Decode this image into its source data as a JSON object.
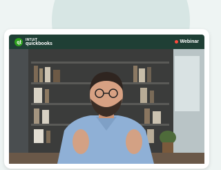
{
  "header": {
    "brand_top": "INTUIT",
    "brand_bottom": "quickbooks",
    "badge_label": "Webinar"
  },
  "icons": {
    "logo": "quickbooks-logo-icon",
    "live": "live-dot-icon"
  },
  "colors": {
    "header_bg": "#1f3f35",
    "brand_green": "#2ca01c",
    "live_red": "#ff4a3d",
    "page_bg": "#eef4f3"
  },
  "video": {
    "description_icon": "webinar-presenter-image"
  }
}
